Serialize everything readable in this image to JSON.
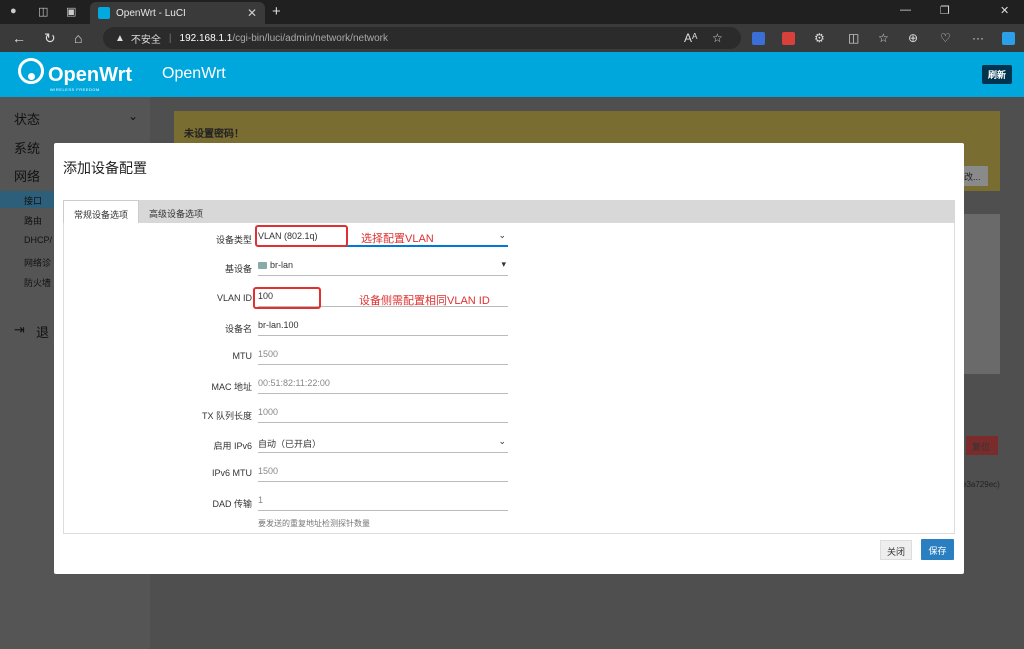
{
  "browser": {
    "tab_title": "OpenWrt - LuCI",
    "tab_close": "✕",
    "new_tab": "+",
    "security_warning": "不安全",
    "url_host": "192.168.1.1",
    "url_path": "/cgi-bin/luci/admin/network/network",
    "reader": "Aᴬ",
    "more": "···"
  },
  "header": {
    "brand": "OpenWrt",
    "brand_tagline": "WIRELESS FREEDOM",
    "hostname": "OpenWrt",
    "refresh_label": "刷新"
  },
  "sidebar": {
    "items": [
      "状态",
      "系统",
      "网络"
    ],
    "sub_items": [
      "接口",
      "路由",
      "DHCP/",
      "网络诊",
      "防火墙"
    ],
    "logout": "退"
  },
  "background": {
    "warning_title": "未设置密码！",
    "bg_button": "改...",
    "reset_button": "复位",
    "hash": "e3a729ec)"
  },
  "modal": {
    "title": "添加设备配置",
    "tabs": [
      "常规设备选项",
      "高级设备选项"
    ],
    "fields": [
      {
        "label": "设备类型",
        "value": "VLAN (802.1q)"
      },
      {
        "label": "基设备",
        "value": "br-lan"
      },
      {
        "label": "VLAN ID",
        "value": "100"
      },
      {
        "label": "设备名",
        "value": "br-lan.100"
      },
      {
        "label": "MTU",
        "value": "1500"
      },
      {
        "label": "MAC 地址",
        "value": "00:51:82:11:22:00"
      },
      {
        "label": "TX 队列长度",
        "value": "1000"
      },
      {
        "label": "启用 IPv6",
        "value": "自动（已开启）"
      },
      {
        "label": "IPv6 MTU",
        "value": "1500"
      },
      {
        "label": "DAD 传输",
        "value": "1"
      }
    ],
    "dad_hint": "要发送的重复地址检测探针数量",
    "close_label": "关闭",
    "save_label": "保存"
  },
  "annotations": {
    "vlan_type": "选择配置VLAN",
    "vlan_id": "设备侧需配置相同VLAN ID"
  },
  "colors": {
    "brand": "#00a7dd",
    "save": "#2a7fc0",
    "annotation": "#e03030"
  }
}
